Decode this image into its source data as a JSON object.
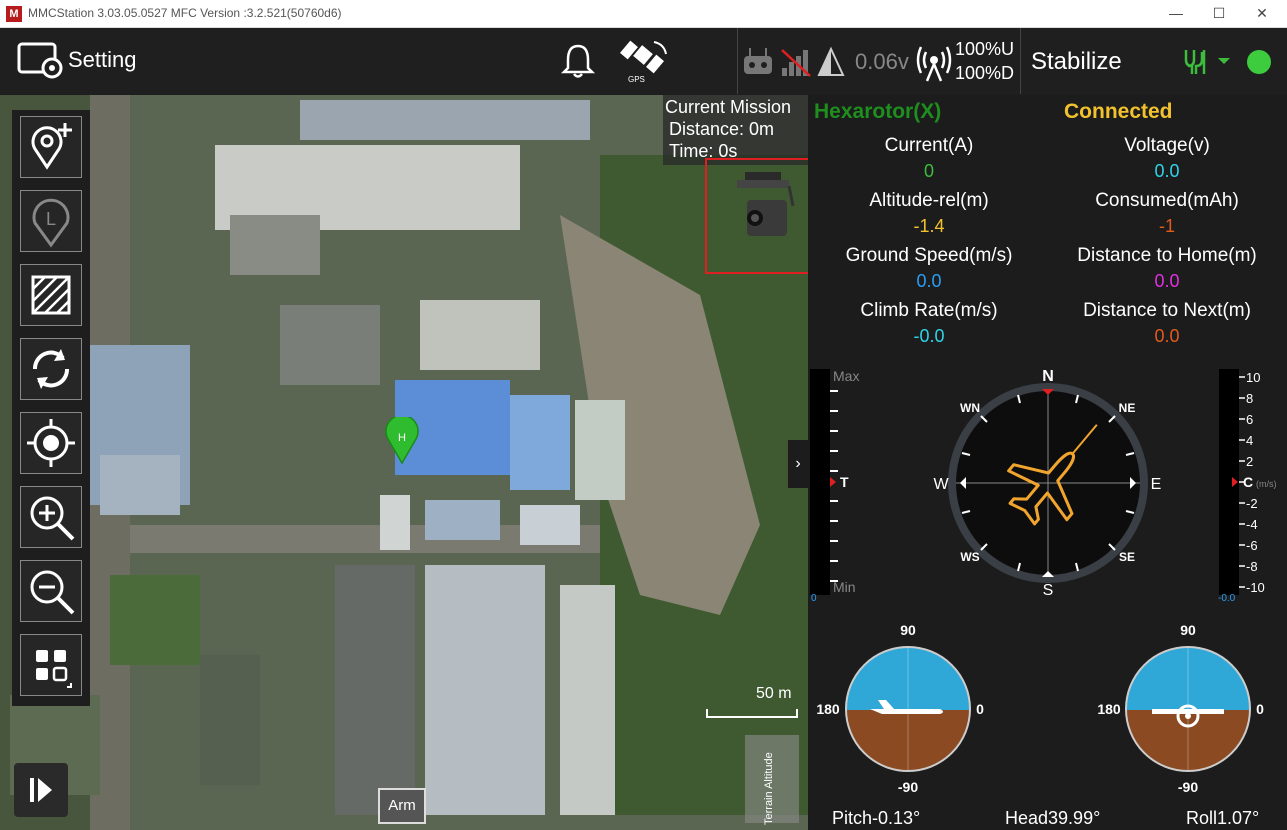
{
  "titlebar": {
    "title": "MMCStation 3.03.05.0527 MFC Version :3.2.521(50760d6)",
    "app_icon_letter": "M",
    "minimize": "—",
    "maximize": "☐",
    "close": "✕"
  },
  "topbar": {
    "setting_label": "Setting",
    "gps_label": "GPS",
    "voltage": "0.06v",
    "link_up": "100%U",
    "link_down": "100%D",
    "mode": "Stabilize"
  },
  "mission": {
    "title": "Current Mission",
    "distance": "Distance: 0m",
    "time": "Time: 0s"
  },
  "map": {
    "home_marker": "H",
    "scale": "50 m",
    "arm_button": "Arm",
    "terrain_label": "Terrain Altitude"
  },
  "telemetry": {
    "vehicle": "Hexarotor(X)",
    "status": "Connected",
    "items": [
      {
        "label": "Current(A)",
        "value": "0",
        "color": "#3dbd3d"
      },
      {
        "label": "Voltage(v)",
        "value": "0.0",
        "color": "#2fd3e8"
      },
      {
        "label": "Altitude-rel(m)",
        "value": "-1.4",
        "color": "#f2c12e"
      },
      {
        "label": "Consumed(mAh)",
        "value": "-1",
        "color": "#e25a1c"
      },
      {
        "label": "Ground Speed(m/s)",
        "value": "0.0",
        "color": "#2a9df4"
      },
      {
        "label": "Distance to Home(m)",
        "value": "0.0",
        "color": "#e030e0"
      },
      {
        "label": "Climb Rate(m/s)",
        "value": "-0.0",
        "color": "#2fd3e8"
      },
      {
        "label": "Distance to Next(m)",
        "value": "0.0",
        "color": "#e25a1c"
      }
    ]
  },
  "altitude_tape": {
    "max": "Max",
    "min": "Min",
    "marker": "T",
    "zero": "0"
  },
  "climb_tape": {
    "ticks": [
      "10",
      "8",
      "6",
      "4",
      "2",
      "0",
      "-2",
      "-4",
      "-6",
      "-8",
      "-10"
    ],
    "marker": "C",
    "unit": "(m/s)",
    "readout": "-0.0"
  },
  "compass": {
    "n": "N",
    "s": "S",
    "e": "E",
    "w": "W",
    "ne": "NE",
    "nw": "WN",
    "se": "SE",
    "sw": "WS",
    "heading_deg": 39.99
  },
  "attitude_left": {
    "top": "90",
    "bottom": "-90",
    "left": "180",
    "right": "0",
    "pitch_deg": -0.13
  },
  "attitude_right": {
    "top": "90",
    "bottom": "-90",
    "left": "180",
    "right": "0",
    "roll_deg": 1.07
  },
  "readouts": {
    "pitch": "Pitch-0.13°",
    "head": "Head39.99°",
    "roll": "Roll1.07°"
  },
  "colors": {
    "accent_green": "#3dbd3d",
    "status_yellow": "#f2c12e",
    "vehicle_green": "#1e8f1e",
    "highlight_red": "#e02020"
  },
  "icons": [
    "bell-icon",
    "gps-satellite-icon",
    "remote-controller-icon",
    "signal-bars-icon",
    "battery-triangle-icon",
    "radio-antenna-icon",
    "connection-plug-icon",
    "status-dot-icon"
  ]
}
